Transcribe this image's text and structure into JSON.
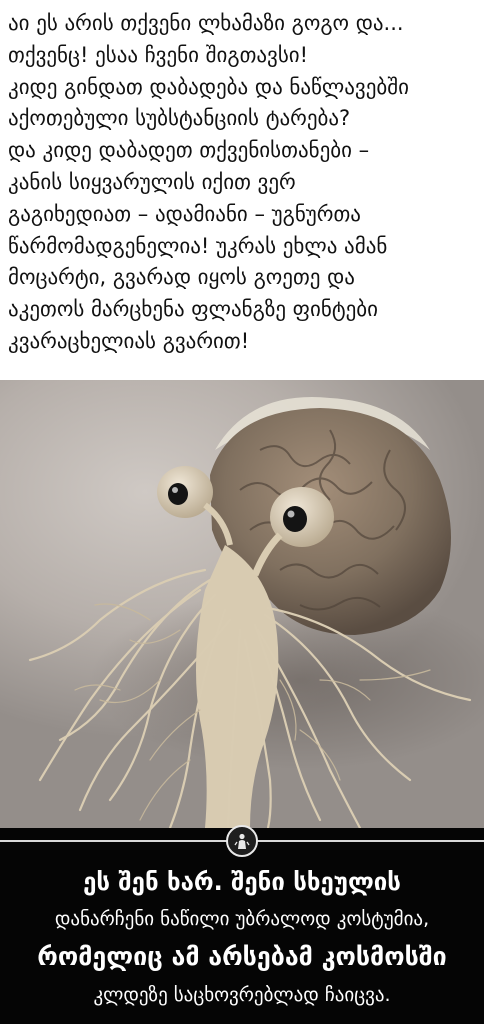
{
  "post_text": {
    "lines": [
      "აი ეს არის თქვენი ლხამაზი გოგო და...",
      "თქვენც! ესაა ჩვენი შიგთავსი!",
      "კიდე გინდათ დაბადება და ნაწლავებში",
      "აქოთებული სუბსტანციის ტარება?",
      "და კიდე დაბადეთ თქვენისთანები –",
      "კანის სიყვარულის იქით ვერ",
      "გაგიხედიათ – ადამიანი – უგნურთა",
      "წარმომადგენელია! უკრას ეხლა ამან",
      "მოცარტი, გვარად იყოს გოეთე და",
      "აკეთოს მარცხენა ფლანგზე ფინტები",
      "კვარაცხელიას გვარით!"
    ]
  },
  "photo": {
    "icon": "brain-creature-photo"
  },
  "caption": {
    "emblem_icon": "figure-emblem-icon",
    "line1": "ეს შენ ხარ. შენი სხეულის",
    "line2": "დანარჩენი ნაწილი უბრალოდ კოსტუმია,",
    "line3": "რომელიც ამ არსებამ კოსმოსში",
    "line4": "კლდეზე საცხოვრებლად ჩაიცვა."
  },
  "colors": {
    "page_background": "#ffffff",
    "caption_background": "#050505",
    "caption_text": "#ffffff",
    "body_text": "#111111"
  }
}
